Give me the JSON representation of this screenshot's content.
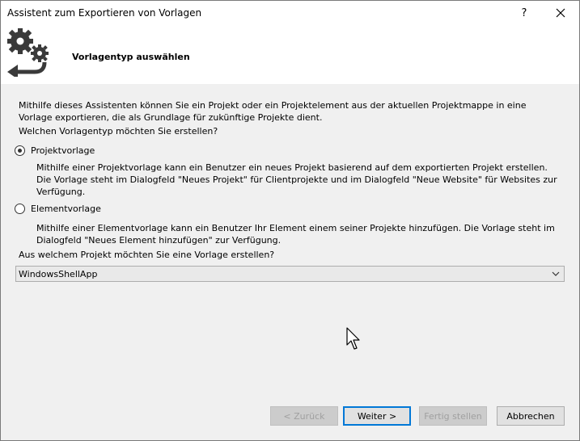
{
  "window": {
    "title": "Assistent zum Exportieren von Vorlagen",
    "help_label": "?"
  },
  "banner": {
    "icon": "gears-export-icon",
    "title": "Vorlagentyp auswählen"
  },
  "content": {
    "intro": "Mithilfe dieses Assistenten können Sie ein Projekt oder ein Projektelement aus der aktuellen Projektmappe in eine Vorlage exportieren, die als Grundlage für zukünftige Projekte dient.",
    "question_type": "Welchen Vorlagentyp möchten Sie erstellen?",
    "options": [
      {
        "label": "Projektvorlage",
        "checked": true,
        "description": "Mithilfe einer Projektvorlage kann ein Benutzer ein neues Projekt basierend auf dem exportierten Projekt erstellen. Die Vorlage steht im Dialogfeld \"Neues Projekt\" für Clientprojekte und im Dialogfeld \"Neue Website\" für Websites zur Verfügung."
      },
      {
        "label": "Elementvorlage",
        "checked": false,
        "description": "Mithilfe einer Elementvorlage kann ein Benutzer Ihr Element einem seiner Projekte hinzufügen. Die Vorlage steht im Dialogfeld \"Neues Element hinzufügen\" zur Verfügung."
      }
    ],
    "question_project": "Aus welchem Projekt möchten Sie eine Vorlage erstellen?",
    "project_select": {
      "selected": "WindowsShellApp"
    }
  },
  "buttons": {
    "back": "< Zurück",
    "next": "Weiter >",
    "finish": "Fertig stellen",
    "cancel": "Abbrechen"
  },
  "colors": {
    "focus_border": "#0078d7",
    "dialog_bg": "#f0f0f0",
    "banner_bg": "#ffffff",
    "disabled_text": "#a0a0a0"
  }
}
